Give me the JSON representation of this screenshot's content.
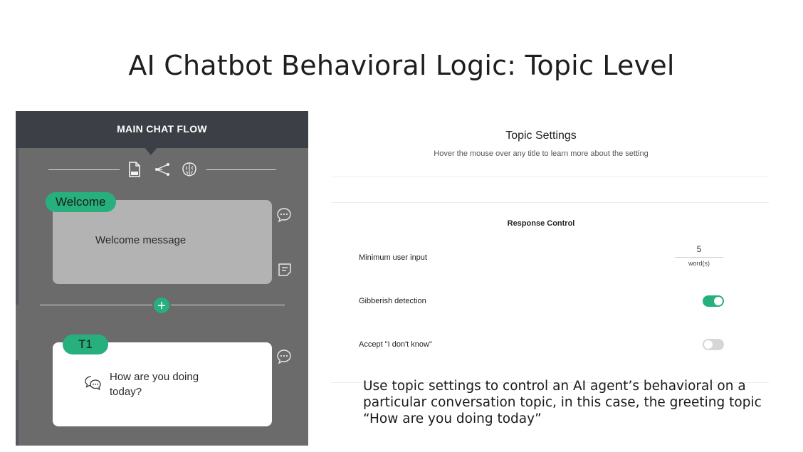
{
  "slide": {
    "title": "AI Chatbot Behavioral Logic: Topic Level",
    "caption": "Use topic settings to control an AI agent’s behavioral on a particular conversation topic, in this case, the greeting topic “How are you doing today”"
  },
  "flow_panel": {
    "header": "MAIN CHAT FLOW",
    "toolbar_icons": [
      "document-icon",
      "share-nodes-icon",
      "brain-icon"
    ],
    "topics": [
      {
        "tag": "Welcome",
        "text": "Welcome message"
      },
      {
        "tag": "T1",
        "text": "How are you doing today?"
      }
    ],
    "add_button_label": "+"
  },
  "settings": {
    "title": "Topic Settings",
    "hint": "Hover the mouse over any title to learn more about the setting",
    "section_title": "Response Control",
    "min_input": {
      "label": "Minimum user input",
      "value": "5",
      "unit": "word(s)"
    },
    "gibberish": {
      "label": "Gibberish detection",
      "enabled": true
    },
    "accept_idk": {
      "label": "Accept \"I don't know\"",
      "enabled": false
    }
  },
  "colors": {
    "accent": "#27b07e",
    "panel_bg": "#6b6b6b",
    "header_bg": "#3c3f45",
    "toggle_off": "#d6d6d6"
  }
}
